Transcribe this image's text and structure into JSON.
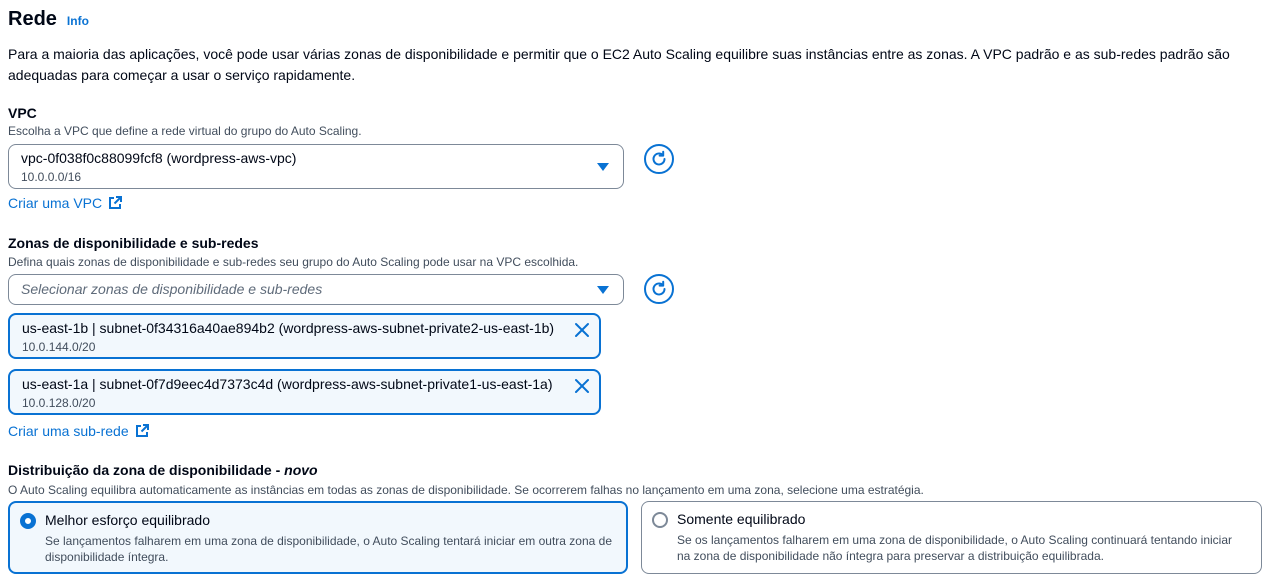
{
  "section": {
    "title": "Rede",
    "info_link": "Info",
    "description": "Para a maioria das aplicações, você pode usar várias zonas de disponibilidade e permitir que o EC2 Auto Scaling equilibre suas instâncias entre as zonas. A VPC padrão e as sub-redes padrão são adequadas para começar a usar o serviço rapidamente."
  },
  "vpc": {
    "label": "VPC",
    "hint": "Escolha a VPC que define a rede virtual do grupo do Auto Scaling.",
    "selected_value": "vpc-0f038f0c88099fcf8 (wordpress-aws-vpc)",
    "selected_sub": "10.0.0.0/16",
    "create_link": "Criar uma VPC",
    "refresh_icon": "refresh-icon"
  },
  "subnets": {
    "label": "Zonas de disponibilidade e sub-redes",
    "hint": "Defina quais zonas de disponibilidade e sub-redes seu grupo do Auto Scaling pode usar na VPC escolhida.",
    "placeholder": "Selecionar zonas de disponibilidade e sub-redes",
    "tokens": [
      {
        "label": "us-east-1b | subnet-0f34316a40ae894b2 (wordpress-aws-subnet-private2-us-east-1b)",
        "cidr": "10.0.144.0/20"
      },
      {
        "label": "us-east-1a | subnet-0f7d9eec4d7373c4d (wordpress-aws-subnet-private1-us-east-1a)",
        "cidr": "10.0.128.0/20"
      }
    ],
    "create_link": "Criar uma sub-rede"
  },
  "distribution": {
    "label": "Distribuição da zona de disponibilidade - ",
    "label_emphasis": "novo",
    "hint": "O Auto Scaling equilibra automaticamente as instâncias em todas as zonas de disponibilidade. Se ocorrerem falhas no lançamento em uma zona, selecione uma estratégia.",
    "options": [
      {
        "label": "Melhor esforço equilibrado",
        "description": "Se lançamentos falharem em uma zona de disponibilidade, o Auto Scaling tentará iniciar em outra zona de disponibilidade íntegra.",
        "selected": true
      },
      {
        "label": "Somente equilibrado",
        "description": "Se os lançamentos falharem em uma zona de disponibilidade, o Auto Scaling continuará tentando iniciar na zona de disponibilidade não íntegra para preservar a distribuição equilibrada.",
        "selected": false
      }
    ]
  },
  "colors": {
    "accent": "#0972d3",
    "text": "#000716",
    "secondary_text": "#414d5c",
    "selected_bg": "#f2f8fd"
  }
}
